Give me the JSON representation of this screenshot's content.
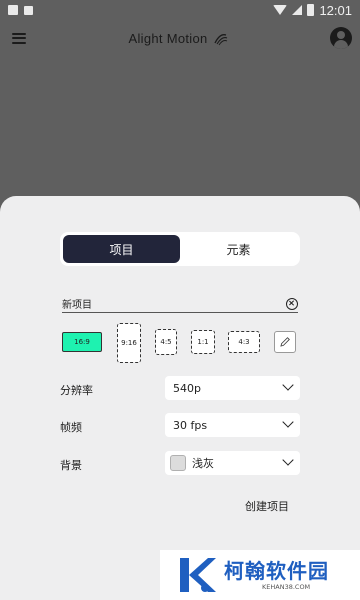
{
  "status_bar": {
    "time": "12:01",
    "left_icons": [
      "image-icon",
      "a-icon"
    ],
    "right_icons": [
      "wifi-icon",
      "signal-icon",
      "battery-icon"
    ]
  },
  "app_bar": {
    "title": "Alight Motion",
    "icons": [
      "menu-icon",
      "alight-motion-logo-icon",
      "profile-icon"
    ]
  },
  "sheet": {
    "tabs": [
      {
        "label": "项目",
        "active": true
      },
      {
        "label": "元素",
        "active": false
      }
    ],
    "project_name": "新项目",
    "ratios": [
      {
        "label": "16:9",
        "selected": true
      },
      {
        "label": "9:16",
        "selected": false
      },
      {
        "label": "4:5",
        "selected": false
      },
      {
        "label": "1:1",
        "selected": false
      },
      {
        "label": "4:3",
        "selected": false
      }
    ],
    "resolution": {
      "label": "分辨率",
      "value": "540p"
    },
    "framerate": {
      "label": "帧频",
      "value": "30 fps"
    },
    "background": {
      "label": "背景",
      "value": "浅灰",
      "swatch_color": "#dcdcdc"
    },
    "create_label": "创建项目"
  },
  "watermark": {
    "title": "柯翰软件园",
    "subtitle": "KEHAN38.COM"
  },
  "colors": {
    "accent": "#1ef2b0",
    "tab_active": "#22253a",
    "watermark_blue": "#1f5fc0"
  }
}
